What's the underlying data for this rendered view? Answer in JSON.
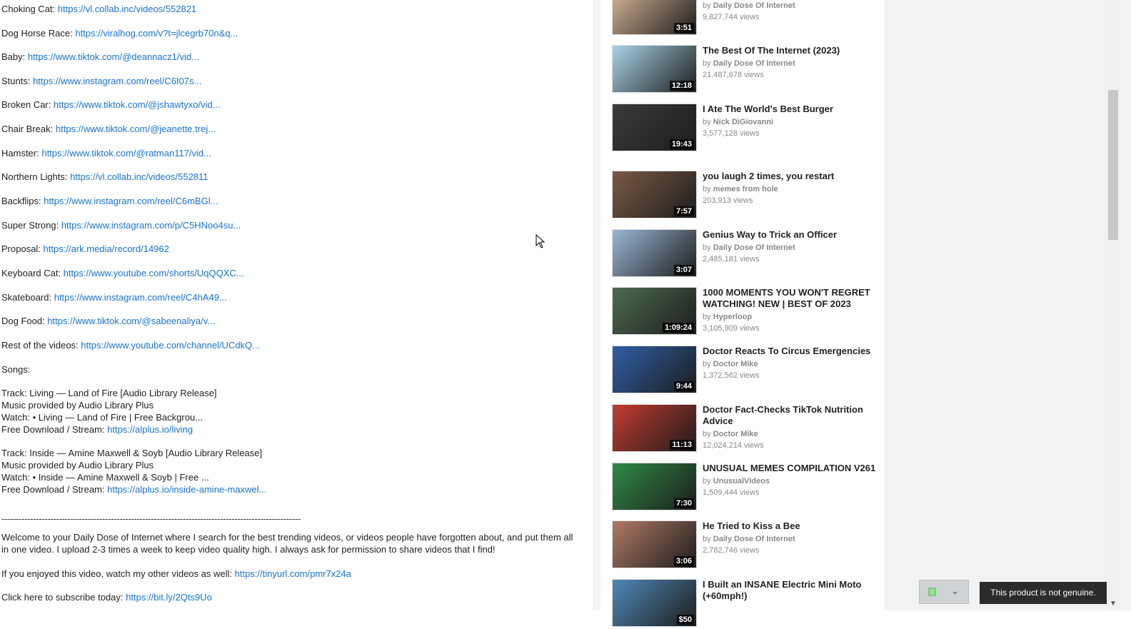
{
  "description": {
    "links": [
      {
        "label": "Choking Cat: ",
        "url": "https://vl.collab.inc/videos/552821"
      },
      {
        "label": "Dog Horse Race: ",
        "url": "https://viralhog.com/v?t=jlcegrb70n&q..."
      },
      {
        "label": "Baby: ",
        "url": "https://www.tiktok.com/@deannacz1/vid..."
      },
      {
        "label": "Stunts: ",
        "url": "https://www.instagram.com/reel/C6I07s..."
      },
      {
        "label": "Broken Car: ",
        "url": "https://www.tiktok.com/@jshawtyxo/vid..."
      },
      {
        "label": "Chair Break: ",
        "url": "https://www.tiktok.com/@jeanette.trej..."
      },
      {
        "label": "Hamster: ",
        "url": "https://www.tiktok.com/@ratman117/vid..."
      },
      {
        "label": "Northern Lights: ",
        "url": "https://vl.collab.inc/videos/552811"
      },
      {
        "label": "Backflips: ",
        "url": "https://www.instagram.com/reel/C6mBGl..."
      },
      {
        "label": "Super Strong: ",
        "url": "https://www.instagram.com/p/C5HNoo4su..."
      },
      {
        "label": "Proposal: ",
        "url": "https://ark.media/record/14962"
      },
      {
        "label": "Keyboard Cat: ",
        "url": "https://www.youtube.com/shorts/UqQQXC..."
      },
      {
        "label": "Skateboard: ",
        "url": "https://www.instagram.com/reel/C4hA49..."
      },
      {
        "label": "Dog Food: ",
        "url": "https://www.tiktok.com/@sabeenaliya/v..."
      },
      {
        "label": "Rest of the videos: ",
        "url": "https://www.youtube.com/channel/UCdkQ..."
      }
    ],
    "songs_heading": "Songs:",
    "track1": {
      "track": "Track: Living — Land of Fire [Audio Library Release]",
      "provider": "Music provided by Audio Library Plus",
      "watch": "Watch: • Living — Land of Fire | Free Backgrou...",
      "download_label": "Free Download / Stream: ",
      "download_url": "https://alplus.io/living"
    },
    "track2": {
      "track": "Track: Inside — Amine Maxwell & Soyb [Audio Library Release]",
      "provider": "Music provided by Audio Library Plus",
      "watch": "Watch: • Inside — Amine Maxwell & Soyb | Free ...",
      "download_label": "Free Download / Stream: ",
      "download_url": "https://alplus.io/inside-amine-maxwel..."
    },
    "divider": "--------------------------------------------------------------------------------------------------------",
    "welcome": "Welcome to your Daily Dose of Internet where I search for the best trending videos, or videos people have forgotten about, and put them all in one video. I upload 2-3 times a week to keep video quality high. I always ask for permission to share videos that I find!",
    "enjoyed_label": "If you enjoyed this video, watch my other videos as well: ",
    "enjoyed_url": "https://tinyurl.com/pmr7x24a",
    "subscribe_label": "Click here to subscribe today: ",
    "subscribe_url": "https://bit.ly/2Qts9Uo"
  },
  "related": [
    {
      "title": "",
      "by": "by ",
      "channel": "Daily Dose Of Internet",
      "views": "9,827,744 views",
      "duration": "3:51",
      "color": "#d9b89a"
    },
    {
      "title": "The Best Of The Internet (2023)",
      "by": "by ",
      "channel": "Daily Dose Of Internet",
      "views": "21,487,678 views",
      "duration": "12:18",
      "color": "#a9d3e8"
    },
    {
      "title": "I Ate The World's Best Burger",
      "by": "by ",
      "channel": "Nick DiGiovanni",
      "views": "3,577,128 views",
      "duration": "19:43",
      "color": "#3b3b3b"
    },
    {
      "title": "you laugh 2 times, you restart",
      "by": "by ",
      "channel": "memes from hole",
      "views": "203,913 views",
      "duration": "7:57",
      "color": "#7a5a45"
    },
    {
      "title": "Genius Way to Trick an Officer",
      "by": "by ",
      "channel": "Daily Dose Of Internet",
      "views": "2,485,181 views",
      "duration": "3:07",
      "color": "#9bb7d6"
    },
    {
      "title": "1000 MOMENTS YOU WON'T REGRET WATCHING! NEW | BEST OF 2023",
      "by": "by ",
      "channel": "Hyperloop",
      "views": "3,105,909 views",
      "duration": "1:09:24",
      "color": "#4e6b50"
    },
    {
      "title": "Doctor Reacts To Circus Emergencies",
      "by": "by ",
      "channel": "Doctor Mike",
      "views": "1,372,562 views",
      "duration": "9:44",
      "color": "#2f5fa8"
    },
    {
      "title": "Doctor Fact-Checks TikTok Nutrition Advice",
      "by": "by ",
      "channel": "Doctor Mike",
      "views": "12,024,214 views",
      "duration": "11:13",
      "color": "#c43b2f"
    },
    {
      "title": "UNUSUAL MEMES COMPILATION V261",
      "by": "by ",
      "channel": "UnusualVideos",
      "views": "1,509,444 views",
      "duration": "7:30",
      "color": "#2f8a45"
    },
    {
      "title": "He Tried to Kiss a Bee",
      "by": "by ",
      "channel": "Daily Dose Of Internet",
      "views": "2,782,746 views",
      "duration": "3:06",
      "color": "#b07a66"
    },
    {
      "title": "I Built an INSANE Electric Mini Moto (+60mph!)",
      "by": "",
      "channel": "",
      "views": "",
      "duration": "$50",
      "color": "#4f88b8"
    }
  ],
  "footer": {
    "counter_value": "0",
    "toast": "This product is not genuine."
  }
}
